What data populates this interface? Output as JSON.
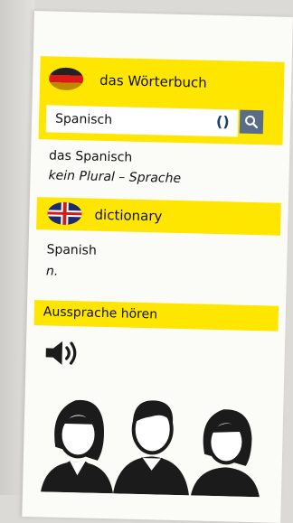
{
  "header": {
    "title": "das Wörterbuch"
  },
  "search": {
    "value": "Spanisch",
    "clear_glyph": "()"
  },
  "german_entry": {
    "word": "das Spanisch",
    "grammar": "kein Plural – Sprache"
  },
  "dictionary_header": {
    "title": "dictionary"
  },
  "english_entry": {
    "word": "Spanish",
    "pos": "n."
  },
  "pronunciation": {
    "label": "Aussprache hören"
  },
  "colors": {
    "accent_yellow": "#ffe600",
    "search_button": "#5a6d86"
  },
  "icons": [
    "german-flag-icon",
    "uk-flag-icon",
    "clear-icon",
    "search-icon",
    "speaker-icon",
    "people-illustration"
  ]
}
